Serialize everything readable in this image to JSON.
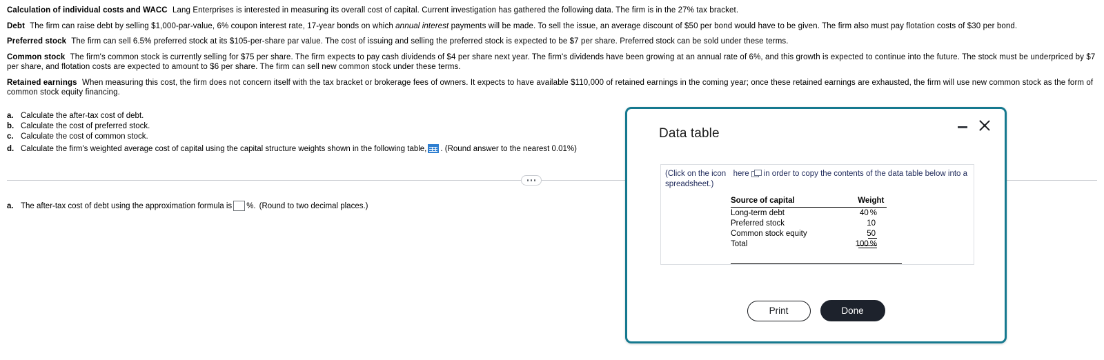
{
  "problem": {
    "title": "Calculation of individual costs and WACC",
    "intro": "Lang Enterprises is interested in measuring its overall cost of capital.  Current investigation has gathered the following data.  The firm is in the 27% tax bracket.",
    "debt_label": "Debt",
    "debt_text_1": "The firm can raise debt by selling $1,000-par-value, 6% coupon interest rate, 17-year bonds on which",
    "debt_italic": "annual interest",
    "debt_text_2": "payments will be made.  To sell the issue, an average discount of $50 per bond would have to be given.  The firm also must pay flotation costs of $30 per bond.",
    "preferred_label": "Preferred stock",
    "preferred_text": "The firm can sell 6.5% preferred stock at its $105-per-share par value.  The cost of issuing and selling the preferred stock is expected to be $7 per share. Preferred stock can be sold under these terms.",
    "common_label": "Common stock",
    "common_text": "The firm's common stock is currently selling for $75 per share.  The firm expects to pay cash dividends of $4 per share next year.  The firm's dividends have been growing at an annual rate of 6%, and this growth is expected to continue into the future.  The stock must be underpriced by $7 per share, and flotation costs are expected to amount to $6 per share. The firm can sell new common stock under these terms.",
    "retained_label": "Retained earnings",
    "retained_text": "When measuring this cost, the firm does not concern itself with the tax bracket or brokerage fees of owners.  It expects to have available $110,000 of retained earnings in the coming year; once these retained earnings are exhausted, the firm will use new common stock as the form of common stock equity financing."
  },
  "questions": [
    {
      "label": "a.",
      "text": "Calculate the after-tax cost of debt."
    },
    {
      "label": "b.",
      "text": "Calculate the cost of preferred stock."
    },
    {
      "label": "c.",
      "text": "Calculate the cost of common stock."
    }
  ],
  "question_d": {
    "label": "d.",
    "text_before": "Calculate the firm's weighted average cost of capital using the capital structure weights shown in the following table,",
    "icon": "table-grid-icon",
    "text_after": ".  (Round answer to the nearest 0.01%)"
  },
  "answer": {
    "label": "a.",
    "text_before": "The after-tax cost of debt using the approximation formula is",
    "input_value": "",
    "unit": "%.",
    "text_after": "(Round to two decimal places.)"
  },
  "dialog": {
    "title": "Data table",
    "minimize_icon": "minimize-icon",
    "close_icon": "close-icon",
    "note_before": "(Click on the icon",
    "note_here": "here",
    "note_icon": "copy-icon",
    "note_after": "in order to copy the contents of the data table below into a spreadsheet.)",
    "table": {
      "headers": [
        "Source of capital",
        "Weight"
      ],
      "rows": [
        {
          "source": "Long-term debt",
          "weight": "40",
          "pct": "%"
        },
        {
          "source": "Preferred stock",
          "weight": "10",
          "pct": ""
        },
        {
          "source": "Common stock equity",
          "weight": "50",
          "pct": ""
        }
      ],
      "total": {
        "source": "Total",
        "weight": "100",
        "pct": "%"
      }
    },
    "print_label": "Print",
    "done_label": "Done"
  },
  "divider": {
    "dots_icon": "more-dots-icon"
  },
  "colors": {
    "dialog_border": "#15798f",
    "note_text": "#1f2a5b",
    "table_icon": "#2f7fd1",
    "done_button": "#1d222c"
  }
}
